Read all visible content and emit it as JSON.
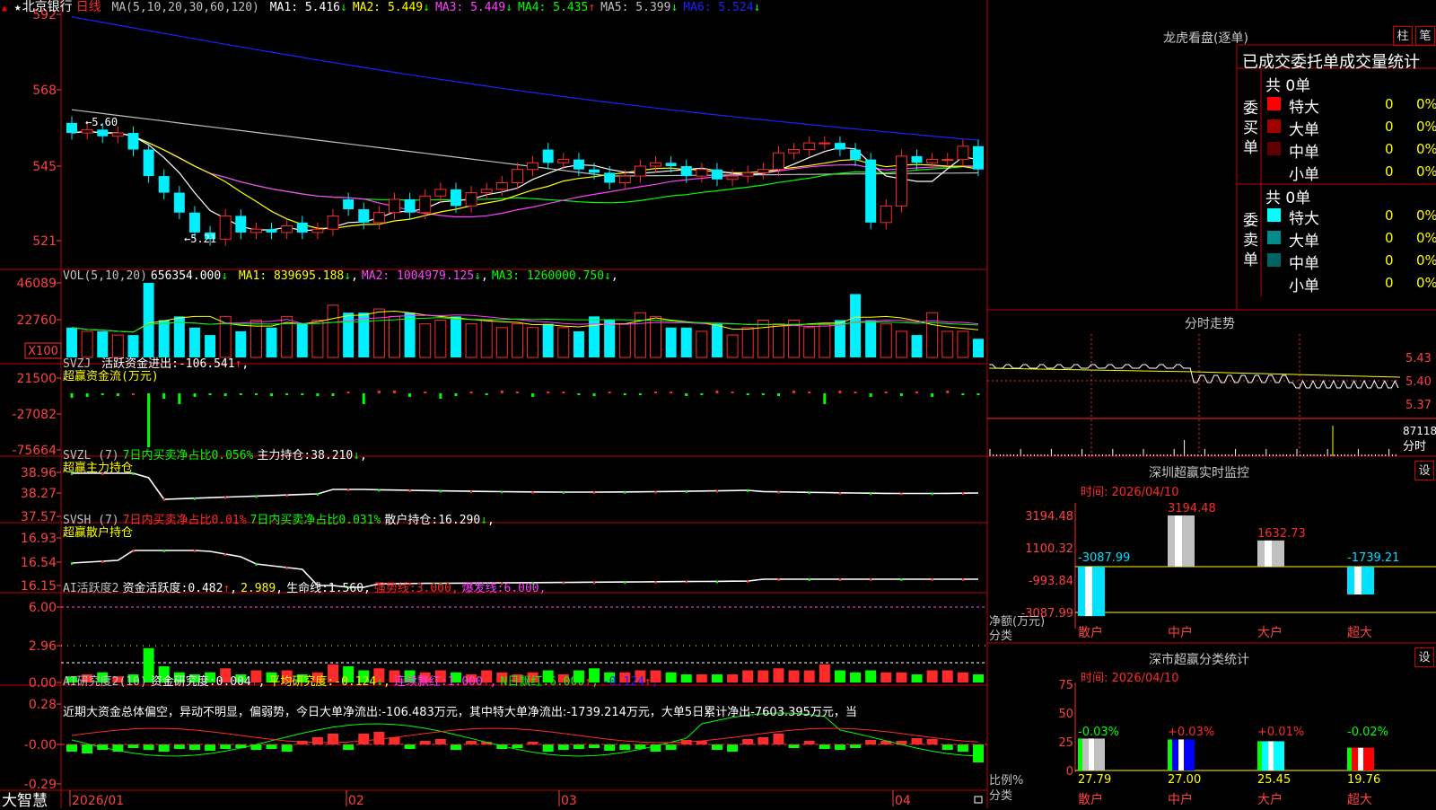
{
  "colors": {
    "up": "#ff2a2a",
    "down": "#00f0ff",
    "ma1": "#ffffff",
    "ma2": "#ffff00",
    "ma3": "#ff40ff",
    "ma4": "#00ff00",
    "ma5": "#c0c0c0",
    "ma6": "#2020ff",
    "grid": "#c00000",
    "axisText": "#ff4040",
    "white": "#ffffff",
    "yellow": "#ffff00",
    "magenta": "#ff40ff",
    "green": "#00ff00",
    "gray": "#c0c0c0",
    "blue": "#2020ff"
  },
  "main": {
    "star": "★",
    "stock_name": "北京银行",
    "period": "日线",
    "ma_param": "MA(5,10,20,30,60,120)",
    "ma_items": [
      {
        "label": "MA1:",
        "value": "5.416",
        "arrow": "↓",
        "color": "ma1"
      },
      {
        "label": "MA2:",
        "value": "5.449",
        "arrow": "↓",
        "color": "ma2"
      },
      {
        "label": "MA3:",
        "value": "5.449",
        "arrow": "↓",
        "color": "ma3"
      },
      {
        "label": "MA4:",
        "value": "5.435",
        "arrow": "↑",
        "color": "ma4"
      },
      {
        "label": "MA5:",
        "value": "5.399",
        "arrow": "↓",
        "color": "ma5"
      },
      {
        "label": "MA6:",
        "value": "5.524",
        "arrow": "↓",
        "color": "ma6"
      }
    ],
    "high_label": "5.60",
    "low_label": "5.21",
    "yticks": [
      "592",
      "568",
      "545",
      "521"
    ]
  },
  "vol": {
    "header": "VOL(5,10,20)",
    "value": "656354.000",
    "value_arrow": "↓",
    "items": [
      {
        "label": "MA1:",
        "value": "839695.188",
        "arrow": "↓",
        "color": "yellow"
      },
      {
        "label": "MA2:",
        "value": "1004979.125",
        "arrow": "↓",
        "color": "magenta"
      },
      {
        "label": "MA3:",
        "value": "1260000.750",
        "arrow": "↓",
        "color": "green"
      }
    ],
    "yticks": [
      "46089",
      "22760"
    ],
    "unit": "X100"
  },
  "svzj": {
    "header": "SVZJ",
    "label": "活跃资金进出:",
    "value": "-106.541",
    "arrow": "↑",
    "subtitle": "超赢资金流(万元)",
    "yticks": [
      "21500",
      "-27082",
      "-75664"
    ]
  },
  "svzl": {
    "header": "SVZL (7)",
    "label1": "7日内买卖净占比0.056%",
    "label2": "主力持仓:",
    "value": "38.210",
    "arrow": "↓",
    "subtitle": "超赢主力持仓",
    "yticks": [
      "38.96",
      "38.27",
      "37.57"
    ]
  },
  "svsh": {
    "header": "SVSH (7)",
    "label1": "7日内买卖净占比0.01%",
    "label2": "7日内买卖净占比0.031%",
    "label3": "散户持仓:",
    "value": "16.290",
    "arrow": "↓",
    "subtitle": "超赢散户持仓",
    "yticks": [
      "16.93",
      "16.54",
      "16.15"
    ]
  },
  "ai1": {
    "header": "AI活跃度2",
    "label": "资金活跃度:",
    "v1": "0.482",
    "a1": "↑",
    "v2": "2.989",
    "label2": "生命线:",
    "v3": "1.560",
    "label3": "强势线:",
    "v4": "3.000",
    "label4": "爆发线:",
    "v5": "6.000",
    "yticks": [
      "6.00",
      "2.96",
      "0.00"
    ]
  },
  "ai2": {
    "header": "AI研究度2(10)",
    "label": "资金研究度:",
    "v1": "0.004",
    "a1": "↑",
    "label2": "平均研究度:",
    "v2": "-0.124",
    "a2": "↓",
    "label3": "连续飘红:",
    "v3": "1.000",
    "a3": "↑",
    "label4": "N日飘红:",
    "v4": "6.000",
    "a4": "↑",
    "v5": "-0.124",
    "a5": "↑",
    "commentary": "近期大资金总体偏空，异动不明显，偏弱势，今日大单净流出:-106.483万元，其中特大单净流出:-1739.214万元，大单5日累计净出-7603.395万元，当",
    "yticks": [
      "0.28",
      "-0.00",
      "-0.29"
    ]
  },
  "xaxis": {
    "labels": [
      "2026/01",
      "02",
      "03",
      "04"
    ]
  },
  "logo": "大智慧",
  "dragon": {
    "title": "龙虎看盘(逐单)",
    "btn1": "柱",
    "btn2": "笔",
    "tabs": "已成交委托单成交量统计",
    "buy": {
      "label": "委买单",
      "total": "共 0单",
      "rows": [
        {
          "name": "特大",
          "count": "0",
          "pct": "0%",
          "color": "#ff0000"
        },
        {
          "name": "大单",
          "count": "0",
          "pct": "0%",
          "color": "#a00000"
        },
        {
          "name": "中单",
          "count": "0",
          "pct": "0%",
          "color": "#600000"
        },
        {
          "name": "小单",
          "count": "0",
          "pct": "0%",
          "color": "#000000"
        }
      ]
    },
    "sell": {
      "label": "委卖单",
      "total": "共 0单",
      "rows": [
        {
          "name": "特大",
          "count": "0",
          "pct": "0%",
          "color": "#00ffff"
        },
        {
          "name": "大单",
          "count": "0",
          "pct": "0%",
          "color": "#008c8c"
        },
        {
          "name": "中单",
          "count": "0",
          "pct": "0%",
          "color": "#006464"
        },
        {
          "name": "小单",
          "count": "0",
          "pct": "0%",
          "color": "#000000"
        }
      ]
    }
  },
  "intraday": {
    "title": "分时走势",
    "yticks": [
      "5.43",
      "5.40",
      "5.37"
    ],
    "vol_label": "87118",
    "unit_label": "分时"
  },
  "sz_monitor": {
    "title": "深圳超赢实时监控",
    "btn": "设",
    "time_label": "时间:",
    "time": "2026/04/10",
    "yticks": [
      "3194.48",
      "1100.32",
      "-993.84",
      "-3087.99"
    ],
    "ylabel": "净额(万元)",
    "xlabel": "分类",
    "categories": [
      "散户",
      "中户",
      "大户",
      "超大"
    ],
    "values": [
      "-3087.99",
      "3194.48",
      "1632.73",
      "-1739.21"
    ]
  },
  "sz_class": {
    "title": "深市超赢分类统计",
    "btn": "设",
    "time_label": "时间:",
    "time": "2026/04/10",
    "yticks": [
      "75",
      "50",
      "25",
      "0"
    ],
    "ylabel": "比例%",
    "xlabel": "分类",
    "categories": [
      "散户",
      "中户",
      "大户",
      "超大"
    ],
    "changes": [
      "-0.03%",
      "+0.03%",
      "+0.01%",
      "-0.02%"
    ],
    "values": [
      "27.79",
      "27.00",
      "25.45",
      "19.76"
    ]
  }
}
